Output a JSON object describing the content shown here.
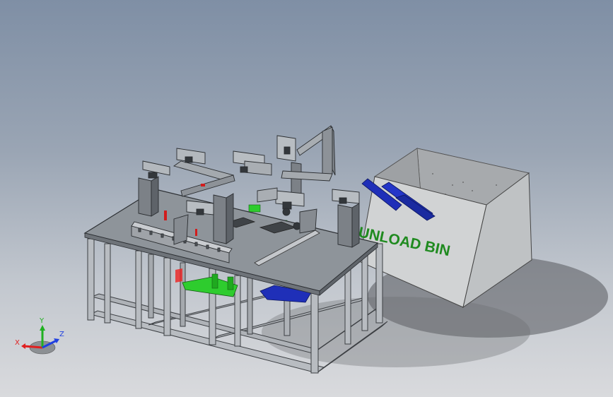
{
  "viewport": {
    "background_top": "#7f8fa5",
    "background_bottom": "#d9dadd"
  },
  "model": {
    "bin_label": "UNLOAD BIN",
    "colors": {
      "frame": "#b8bcc1",
      "table_top": "#8e949a",
      "bin": "#c9cbcc",
      "green_parts": "#2ecc2e",
      "blue_parts": "#1f2fb8",
      "bin_text": "#1f8a1f"
    }
  },
  "triad": {
    "x_label": "X",
    "y_label": "Y",
    "z_label": "Z",
    "colors": {
      "x": "#e02020",
      "y": "#20b020",
      "z": "#2040e0"
    }
  }
}
